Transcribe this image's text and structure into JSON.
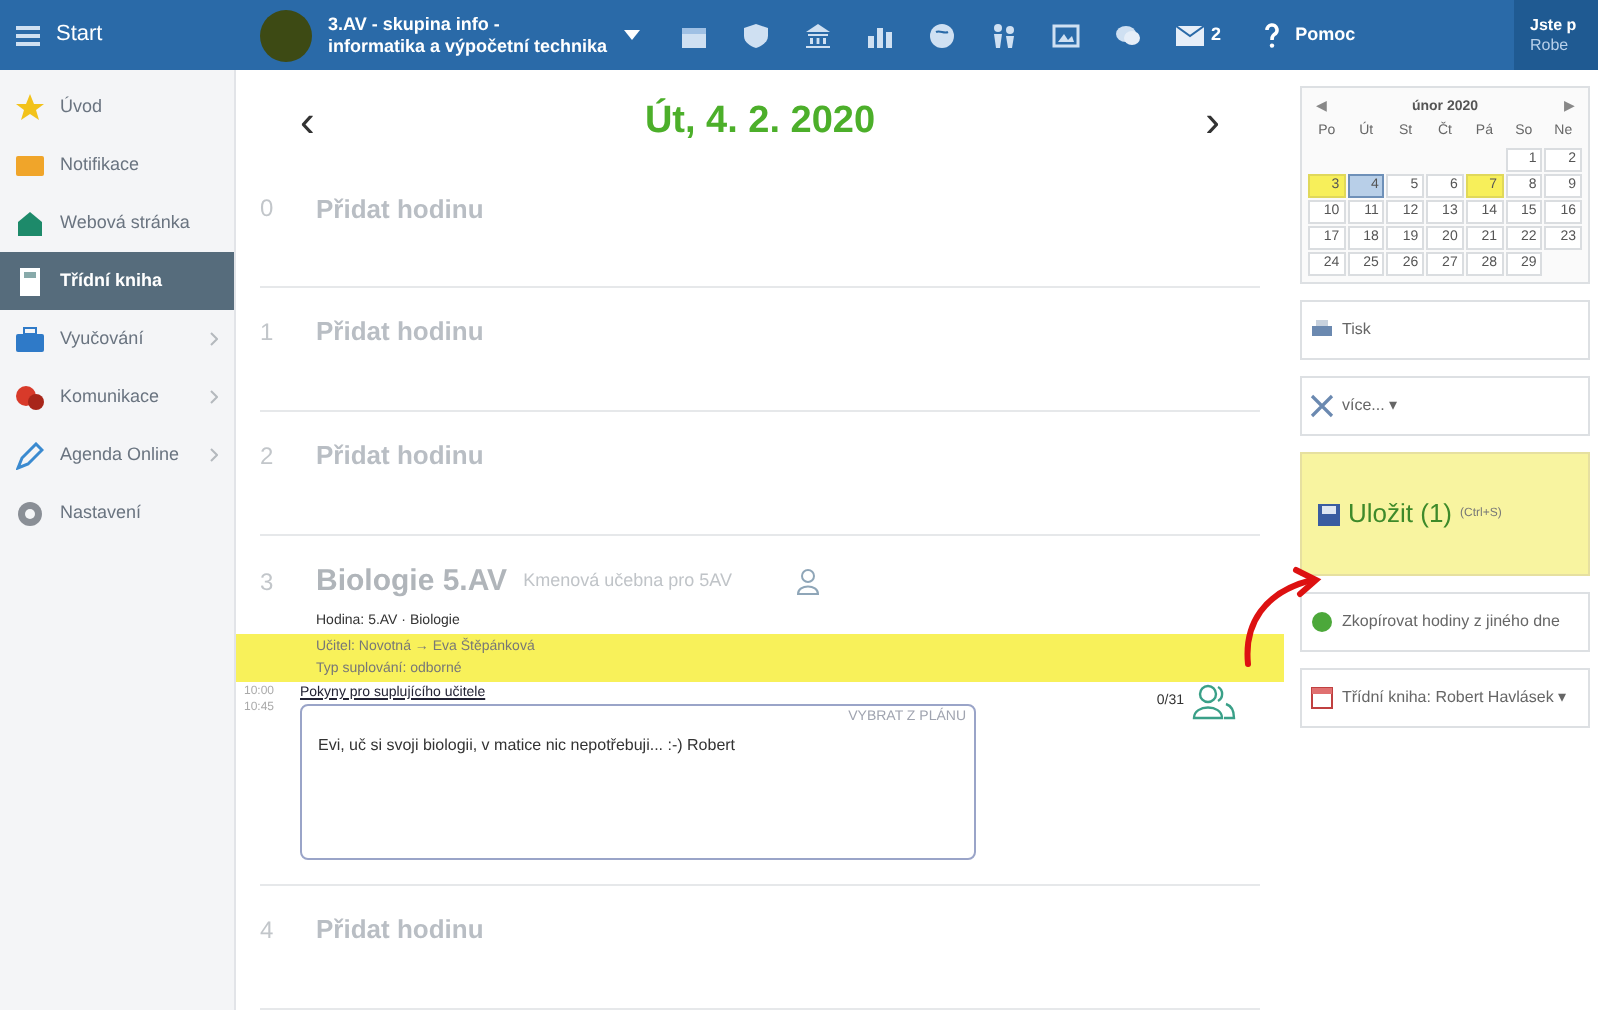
{
  "topbar": {
    "menu_label": "Start",
    "group_line1": "3.AV - skupina info -",
    "group_line2": "informatika a výpočetní technika",
    "message_count": "2",
    "help_label": "Pomoc",
    "user_line1": "Jste p",
    "user_line2": "Robe"
  },
  "sidebar": {
    "items": [
      {
        "label": "Úvod",
        "selected": false,
        "has_submenu": false
      },
      {
        "label": "Notifikace",
        "selected": false,
        "has_submenu": false
      },
      {
        "label": "Webová stránka",
        "selected": false,
        "has_submenu": false
      },
      {
        "label": "Třídní kniha",
        "selected": true,
        "has_submenu": false
      },
      {
        "label": "Vyučování",
        "selected": false,
        "has_submenu": true
      },
      {
        "label": "Komunikace",
        "selected": false,
        "has_submenu": true
      },
      {
        "label": "Agenda Online",
        "selected": false,
        "has_submenu": true
      },
      {
        "label": "Nastavení",
        "selected": false,
        "has_submenu": false
      }
    ]
  },
  "day": {
    "prev": "‹",
    "title": "Út, 4. 2. 2020",
    "next": "›"
  },
  "lessons": [
    {
      "kind": "empty",
      "number": "0",
      "label": "Přidat hodinu"
    },
    {
      "kind": "empty",
      "number": "1",
      "label": "Přidat hodinu"
    },
    {
      "kind": "empty",
      "number": "2",
      "label": "Přidat hodinu"
    },
    {
      "kind": "lesson",
      "number": "3",
      "subject": "Biologie 5.AV",
      "room": "Kmenová učebna pro 5AV",
      "hour_info": "Hodina: 5.AV · Biologie",
      "teacher_info": "Učitel: Novotná → Eva Štěpánková",
      "type_info": "Typ suplování: odborné",
      "time_from": "10:00",
      "time_to": "10:45",
      "instructions_link": "Pokyny pro suplujícího učitele",
      "pick_label": "VYBRAT Z PLÁNU",
      "note": "Evi, uč si svoji biologii, v matice nic nepotřebuji... :-) Robert",
      "attendance": "0/31"
    },
    {
      "kind": "empty",
      "number": "4",
      "label": "Přidat hodinu"
    }
  ],
  "calendar": {
    "prev": "◀",
    "month": "únor 2020",
    "next": "▶",
    "weekdays": [
      "Po",
      "Út",
      "St",
      "Čt",
      "Pá",
      "So",
      "Ne"
    ],
    "weeks": [
      [
        {
          "day": "1",
          "highlighted": false,
          "selected": false
        },
        {
          "day": "2",
          "highlighted": false,
          "selected": false
        }
      ],
      [
        {
          "day": "3",
          "highlighted": true,
          "selected": false
        },
        {
          "day": "4",
          "highlighted": false,
          "selected": true
        },
        {
          "day": "5",
          "highlighted": false,
          "selected": false
        },
        {
          "day": "6",
          "highlighted": false,
          "selected": false
        },
        {
          "day": "7",
          "highlighted": true,
          "selected": false
        },
        {
          "day": "8",
          "highlighted": false,
          "selected": false
        },
        {
          "day": "9",
          "highlighted": false,
          "selected": false
        }
      ],
      [
        {
          "day": "10",
          "highlighted": false,
          "selected": false
        },
        {
          "day": "11",
          "highlighted": false,
          "selected": false
        },
        {
          "day": "12",
          "highlighted": false,
          "selected": false
        },
        {
          "day": "13",
          "highlighted": false,
          "selected": false
        },
        {
          "day": "14",
          "highlighted": false,
          "selected": false
        },
        {
          "day": "15",
          "highlighted": false,
          "selected": false
        },
        {
          "day": "16",
          "highlighted": false,
          "selected": false
        }
      ],
      [
        {
          "day": "17",
          "highlighted": false,
          "selected": false
        },
        {
          "day": "18",
          "highlighted": false,
          "selected": false
        },
        {
          "day": "19",
          "highlighted": false,
          "selected": false
        },
        {
          "day": "20",
          "highlighted": false,
          "selected": false
        },
        {
          "day": "21",
          "highlighted": false,
          "selected": false
        },
        {
          "day": "22",
          "highlighted": false,
          "selected": false
        },
        {
          "day": "23",
          "highlighted": false,
          "selected": false
        }
      ],
      [
        {
          "day": "24",
          "highlighted": false,
          "selected": false
        },
        {
          "day": "25",
          "highlighted": false,
          "selected": false
        },
        {
          "day": "26",
          "highlighted": false,
          "selected": false
        },
        {
          "day": "27",
          "highlighted": false,
          "selected": false
        },
        {
          "day": "28",
          "highlighted": false,
          "selected": false
        },
        {
          "day": "29",
          "highlighted": false,
          "selected": false
        }
      ]
    ]
  },
  "actions": [
    {
      "kind": "print",
      "label": "Tisk"
    },
    {
      "kind": "more",
      "label": "více... ▾"
    },
    {
      "kind": "save",
      "label": "Uložit (1)",
      "shortcut": "(Ctrl+S)"
    },
    {
      "kind": "copy",
      "label": "Zkopírovat hodiny z jiného dne"
    },
    {
      "kind": "book",
      "label": "Třídní kniha: Robert Havlásek ▾"
    }
  ]
}
